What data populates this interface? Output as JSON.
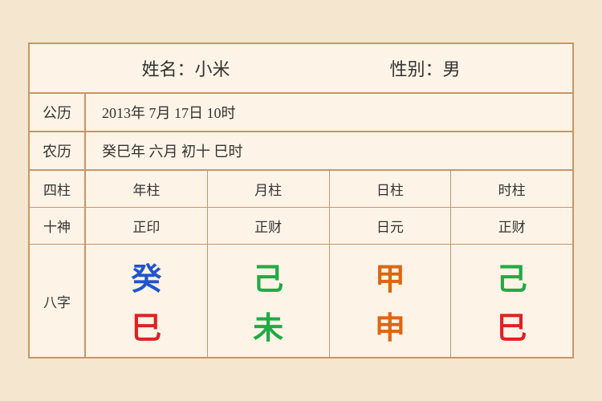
{
  "header": {
    "name_label": "姓名：小米",
    "gender_label": "性别：男"
  },
  "gregorian": {
    "label": "公历",
    "value": "2013年 7月 17日 10时"
  },
  "lunar": {
    "label": "农历",
    "value": "癸巳年 六月 初十 巳时"
  },
  "sijiu_row": {
    "col0": "四柱",
    "col1": "年柱",
    "col2": "月柱",
    "col3": "日柱",
    "col4": "时柱"
  },
  "shishen_row": {
    "col0": "十神",
    "col1": "正印",
    "col2": "正财",
    "col3": "日元",
    "col4": "正财"
  },
  "bazhi": {
    "label": "八字",
    "cols": [
      {
        "top": "癸",
        "top_color": "blue",
        "bottom": "巳",
        "bottom_color": "red"
      },
      {
        "top": "己",
        "top_color": "green",
        "bottom": "未",
        "bottom_color": "green"
      },
      {
        "top": "甲",
        "top_color": "orange",
        "bottom": "申",
        "bottom_color": "orange"
      },
      {
        "top": "己",
        "top_color": "green",
        "bottom": "巳",
        "bottom_color": "red"
      }
    ]
  }
}
